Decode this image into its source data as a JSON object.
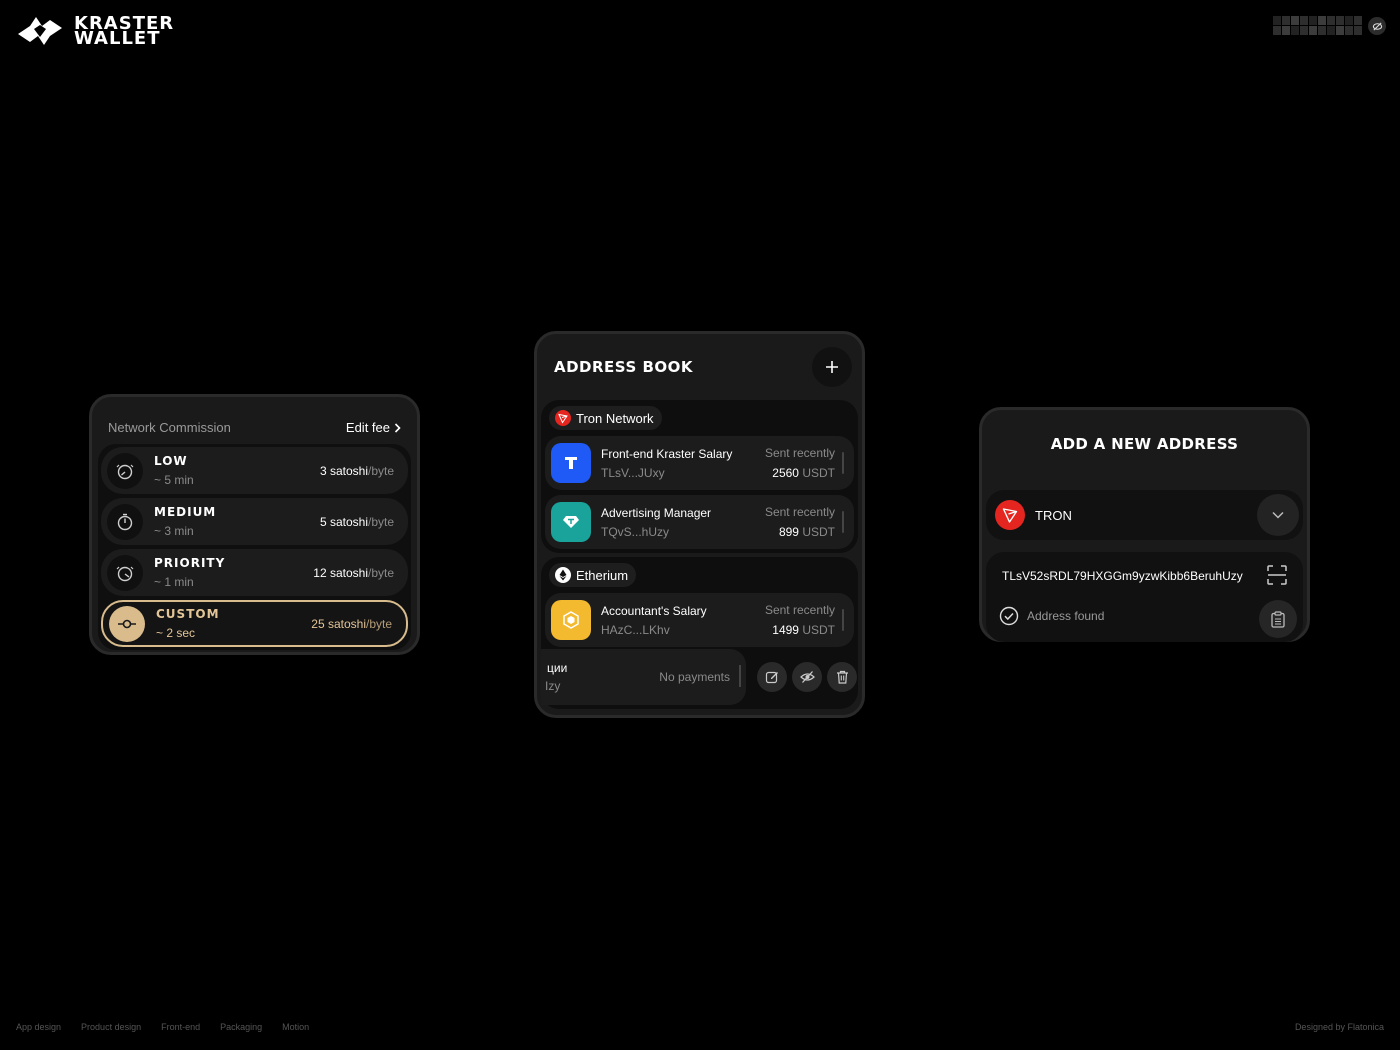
{
  "brand": {
    "line1": "KRASTER",
    "line2": "WALLET"
  },
  "network_commission": {
    "title": "Network Commission",
    "edit_label": "Edit fee",
    "options": [
      {
        "name": "LOW",
        "time": "~ 5 min",
        "amount": "3 satoshi",
        "unit": "/byte",
        "selected": false
      },
      {
        "name": "MEDIUM",
        "time": "~ 3 min",
        "amount": "5 satoshi",
        "unit": "/byte",
        "selected": false
      },
      {
        "name": "PRIORITY",
        "time": "~ 1 min",
        "amount": "12 satoshi",
        "unit": "/byte",
        "selected": false
      },
      {
        "name": "CUSTOM",
        "time": "~ 2 sec",
        "amount": "25 satoshi",
        "unit": "/byte",
        "selected": true
      }
    ]
  },
  "address_book": {
    "title": "ADDRESS BOOK",
    "groups": [
      {
        "network": "Tron Network",
        "items": [
          {
            "name": "Front-end Kraster Salary",
            "address": "TLsV...JUxy",
            "status": "Sent recently",
            "amount": "2560",
            "currency": "USDT",
            "logo_color": "#1f5af6"
          },
          {
            "name": "Advertising Manager",
            "address": "TQvS...hUzy",
            "status": "Sent recently",
            "amount": "899",
            "currency": "USDT",
            "logo_color": "#1aa39a"
          }
        ]
      },
      {
        "network": "Etherium",
        "items": [
          {
            "name": "Accountant's Salary",
            "address": "HAzC...LKhv",
            "status": "Sent recently",
            "amount": "1499",
            "currency": "USDT",
            "logo_color": "#f3ba2f"
          }
        ]
      }
    ],
    "swiped_item": {
      "name_fragment": "ции",
      "address_fragment": "Izy",
      "status": "No payments"
    }
  },
  "add_address": {
    "title": "ADD A NEW ADDRESS",
    "network_label": "TRON",
    "address_value": "TLsV52sRDL79HXGGm9yzwKibb6BeruhUzy",
    "status": "Address found"
  },
  "footer": {
    "nav": [
      "App design",
      "Product design",
      "Front-end",
      "Packaging",
      "Motion"
    ],
    "credit": "Designed by Flatonica"
  }
}
